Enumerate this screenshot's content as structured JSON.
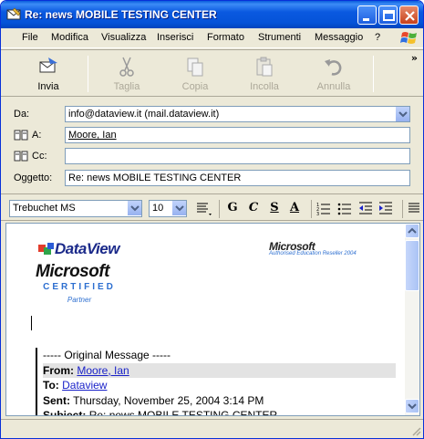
{
  "window": {
    "title": "Re: news MOBILE TESTING CENTER"
  },
  "menu": {
    "items": [
      {
        "label": "File",
        "key": "F"
      },
      {
        "label": "Modifica",
        "key": "M"
      },
      {
        "label": "Visualizza",
        "key": "V"
      },
      {
        "label": "Inserisci",
        "key": "I"
      },
      {
        "label": "Formato",
        "key": "o"
      },
      {
        "label": "Strumenti",
        "key": "S"
      },
      {
        "label": "Messaggio",
        "key": "e"
      },
      {
        "label": "?",
        "key": "?"
      }
    ]
  },
  "toolbar": {
    "send_label": "Invia",
    "cut_label": "Taglia",
    "copy_label": "Copia",
    "paste_label": "Incolla",
    "undo_label": "Annulla",
    "more": "»"
  },
  "header": {
    "from_label": "Da:",
    "from_value": "info@dataview.it    (mail.dataview.it)",
    "to_label": "A:",
    "to_value": "Moore, Ian",
    "cc_label": "Cc:",
    "cc_value": "",
    "subject_label": "Oggetto:",
    "subject_value": "Re: news MOBILE TESTING CENTER"
  },
  "format": {
    "font": "Trebuchet MS",
    "size": "10",
    "bold": "G",
    "italic": "C",
    "underline": "S",
    "color": "A"
  },
  "body": {
    "dataview_logo": "DataView",
    "ms_logo": "Microsoft",
    "certified": "CERTIFIED",
    "partner": "Partner",
    "ms_small": "Microsoft",
    "reseller": "Authorised Education Reseller 2004",
    "original_header": "----- Original Message -----",
    "from_label": "From:",
    "from_value": "Moore, Ian",
    "to_label": "To:",
    "to_value": "Dataview",
    "sent_label": "Sent:",
    "sent_value": "Thursday, November 25, 2004 3:14 PM",
    "subject_label": "Subject:",
    "subject_value": "Re: news MOBILE TESTING CENTER"
  },
  "colors": {
    "titlebar": "#0553d8",
    "link": "#1a22c9",
    "logo_blue": "#2d6fd0"
  }
}
